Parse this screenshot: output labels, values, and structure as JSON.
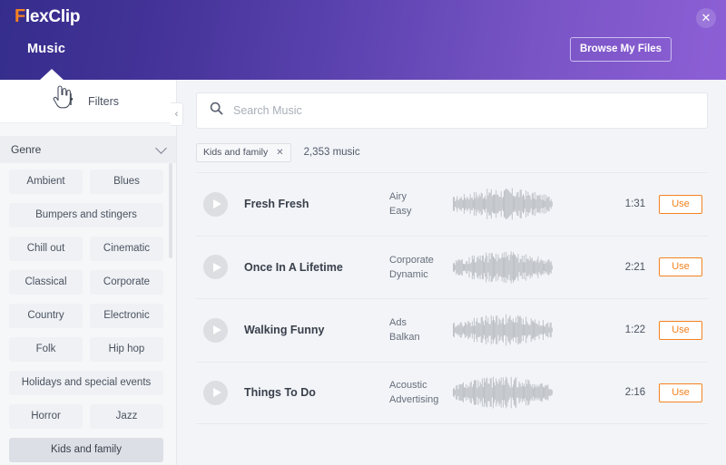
{
  "header": {
    "logo_prefix": "F",
    "logo_rest": "lexClip",
    "tab_music": "Music",
    "browse_button": "Browse My Files",
    "close_icon": "✕",
    "accent_orange": "#f58220",
    "gradient_from": "#352d8c",
    "gradient_to": "#8d5fd6"
  },
  "sidebar": {
    "filters_label": "Filters",
    "collapse_icon": "‹",
    "genre_label": "Genre",
    "genres": [
      {
        "label": "Ambient",
        "width": "half",
        "selected": false
      },
      {
        "label": "Blues",
        "width": "half",
        "selected": false
      },
      {
        "label": "Bumpers and stingers",
        "width": "full",
        "selected": false
      },
      {
        "label": "Chill out",
        "width": "half",
        "selected": false
      },
      {
        "label": "Cinematic",
        "width": "half",
        "selected": false
      },
      {
        "label": "Classical",
        "width": "half",
        "selected": false
      },
      {
        "label": "Corporate",
        "width": "half",
        "selected": false
      },
      {
        "label": "Country",
        "width": "half",
        "selected": false
      },
      {
        "label": "Electronic",
        "width": "half",
        "selected": false
      },
      {
        "label": "Folk",
        "width": "half",
        "selected": false
      },
      {
        "label": "Hip hop",
        "width": "half",
        "selected": false
      },
      {
        "label": "Holidays and special events",
        "width": "full",
        "selected": false
      },
      {
        "label": "Horror",
        "width": "half",
        "selected": false
      },
      {
        "label": "Jazz",
        "width": "half",
        "selected": false
      },
      {
        "label": "Kids and family",
        "width": "full",
        "selected": true
      }
    ]
  },
  "search": {
    "placeholder": "Search Music",
    "value": ""
  },
  "filter_chip": {
    "label": "Kids and family",
    "remove_icon": "✕"
  },
  "results": {
    "count_text": "2,353 music",
    "use_label": "Use",
    "tracks": [
      {
        "title": "Fresh Fresh",
        "tag1": "Airy",
        "tag2": "Easy",
        "duration": "1:31",
        "use": "Use"
      },
      {
        "title": "Once In A Lifetime",
        "tag1": "Corporate",
        "tag2": "Dynamic",
        "duration": "2:21",
        "use": "Use"
      },
      {
        "title": "Walking Funny",
        "tag1": "Ads",
        "tag2": "Balkan",
        "duration": "1:22",
        "use": "Use"
      },
      {
        "title": "Things To Do",
        "tag1": "Acoustic",
        "tag2": "Advertising",
        "duration": "2:16",
        "use": "Use"
      }
    ]
  }
}
